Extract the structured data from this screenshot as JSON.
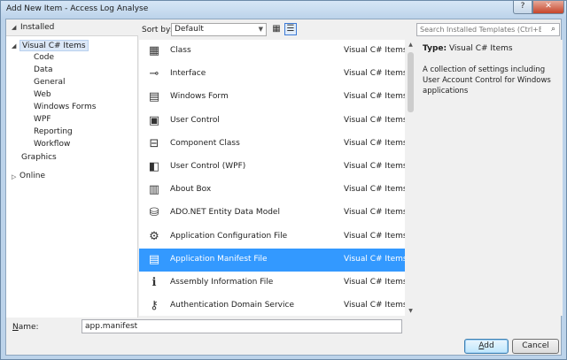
{
  "window": {
    "title": "Add New Item - Access Log Analyse",
    "help_label": "?",
    "close_label": "✕"
  },
  "tree": {
    "header": "Installed",
    "root": "Visual C# Items",
    "children": [
      "Code",
      "Data",
      "General",
      "Web",
      "Windows Forms",
      "WPF",
      "Reporting",
      "Workflow"
    ],
    "graphics": "Graphics",
    "online": "Online"
  },
  "toolbar": {
    "sort_label": "Sort by:",
    "sort_value": "Default"
  },
  "items": [
    {
      "name": "Class",
      "lang": "Visual C# Items",
      "icon": "class-icon",
      "glyph": "▦"
    },
    {
      "name": "Interface",
      "lang": "Visual C# Items",
      "icon": "interface-icon",
      "glyph": "⊸"
    },
    {
      "name": "Windows Form",
      "lang": "Visual C# Items",
      "icon": "windows-form-icon",
      "glyph": "▤"
    },
    {
      "name": "User Control",
      "lang": "Visual C# Items",
      "icon": "user-control-icon",
      "glyph": "▣"
    },
    {
      "name": "Component Class",
      "lang": "Visual C# Items",
      "icon": "component-class-icon",
      "glyph": "⊟"
    },
    {
      "name": "User Control (WPF)",
      "lang": "Visual C# Items",
      "icon": "wpf-user-control-icon",
      "glyph": "◧"
    },
    {
      "name": "About Box",
      "lang": "Visual C# Items",
      "icon": "about-box-icon",
      "glyph": "▥"
    },
    {
      "name": "ADO.NET Entity Data Model",
      "lang": "Visual C# Items",
      "icon": "entity-model-icon",
      "glyph": "⛁"
    },
    {
      "name": "Application Configuration File",
      "lang": "Visual C# Items",
      "icon": "config-file-icon",
      "glyph": "⚙"
    },
    {
      "name": "Application Manifest File",
      "lang": "Visual C# Items",
      "icon": "manifest-file-icon",
      "glyph": "▤"
    },
    {
      "name": "Assembly Information File",
      "lang": "Visual C# Items",
      "icon": "assembly-info-icon",
      "glyph": "ℹ"
    },
    {
      "name": "Authentication Domain Service",
      "lang": "Visual C# Items",
      "icon": "domain-service-icon",
      "glyph": "⚷"
    }
  ],
  "selected_index": 9,
  "search": {
    "placeholder": "Search Installed Templates (Ctrl+E)"
  },
  "details": {
    "type_label": "Type:",
    "type_value": "Visual C# Items",
    "description": "A collection of settings including User Account Control for Windows applications"
  },
  "name_field": {
    "label_underlined": "N",
    "label_rest": "ame:",
    "value": "app.manifest"
  },
  "buttons": {
    "add_underlined": "A",
    "add_rest": "dd",
    "cancel": "Cancel"
  }
}
